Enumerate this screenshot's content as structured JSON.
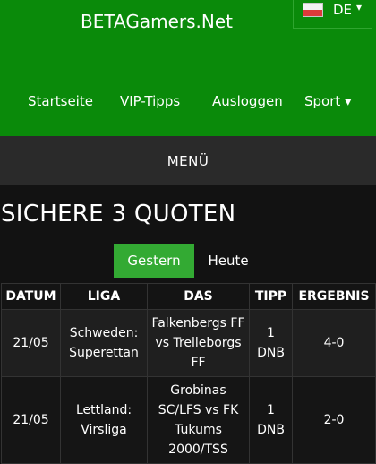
{
  "header": {
    "site_title": "BETAGamers.Net",
    "language": {
      "code": "DE",
      "caret": "▾",
      "flag_icon": "germany-flag-icon"
    },
    "nav": [
      {
        "label": "Startseite"
      },
      {
        "label": "VIP-Tipps"
      },
      {
        "label": "Ausloggen"
      },
      {
        "label": "Sport ▾"
      }
    ]
  },
  "menu": {
    "label": "MENÜ"
  },
  "page": {
    "heading": "SICHERE 3 QUOTEN",
    "tabs": [
      {
        "label": "Gestern",
        "active": true
      },
      {
        "label": "Heute",
        "active": false
      }
    ]
  },
  "table": {
    "headers": [
      "DATUM",
      "LIGA",
      "DAS",
      "TIPP",
      "ERGEBNIS"
    ],
    "rows": [
      {
        "date": "21/05",
        "league": "Schweden: Superettan",
        "match": "Falkenbergs FF vs Trelleborgs FF",
        "tip": "1 DNB",
        "result": "4-0"
      },
      {
        "date": "21/05",
        "league": "Lettland: Virsliga",
        "match": "Grobinas SC/LFS vs FK Tukums 2000/TSS",
        "tip": "1 DNB",
        "result": "2-0"
      }
    ]
  },
  "colors": {
    "header_green": "#0a8a0a",
    "active_tab_green": "#33aa33",
    "menu_bar": "#2a2a2a",
    "background": "#121212"
  }
}
